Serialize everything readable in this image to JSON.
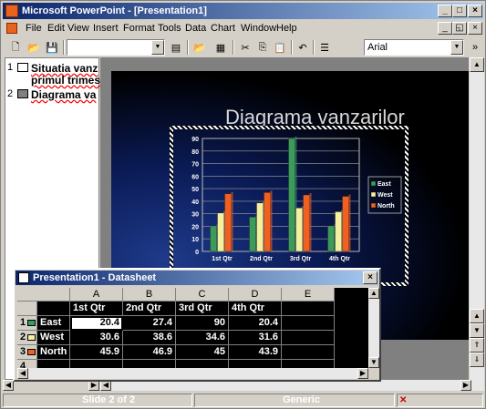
{
  "app": {
    "title": "Microsoft PowerPoint - [Presentation1]"
  },
  "menu": [
    "File",
    "Edit",
    "View",
    "Insert",
    "Format",
    "Tools",
    "Data",
    "Chart",
    "Window",
    "Help"
  ],
  "toolbar": {
    "font_name": "Arial"
  },
  "outline": {
    "slides": [
      {
        "num": "1",
        "text_line1": "Situatia vanz",
        "text_line2": "primul trimes"
      },
      {
        "num": "2",
        "text_line1": "Diagrama va"
      }
    ]
  },
  "slide": {
    "title": "Diagrama vanzarilor"
  },
  "status": {
    "slide": "Slide 2 of 2",
    "design": "Generic"
  },
  "datasheet": {
    "title": "Presentation1 - Datasheet",
    "col_letters": [
      "A",
      "B",
      "C",
      "D",
      "E"
    ],
    "col_headers": [
      "1st Qtr",
      "2nd Qtr",
      "3rd Qtr",
      "4th Qtr"
    ],
    "rows": [
      {
        "num": "1",
        "name": "East",
        "values": [
          "20.4",
          "27.4",
          "90",
          "20.4"
        ]
      },
      {
        "num": "2",
        "name": "West",
        "values": [
          "30.6",
          "38.6",
          "34.6",
          "31.6"
        ]
      },
      {
        "num": "3",
        "name": "North",
        "values": [
          "45.9",
          "46.9",
          "45",
          "43.9"
        ]
      },
      {
        "num": "4",
        "name": "",
        "values": [
          "",
          "",
          "",
          ""
        ]
      }
    ]
  },
  "chart_data": {
    "type": "bar",
    "categories": [
      "1st Qtr",
      "2nd Qtr",
      "3rd Qtr",
      "4th Qtr"
    ],
    "series": [
      {
        "name": "East",
        "values": [
          20.4,
          27.4,
          90,
          20.4
        ],
        "color": "#3c9a5a"
      },
      {
        "name": "West",
        "values": [
          30.6,
          38.6,
          34.6,
          31.6
        ],
        "color": "#f5f0a0"
      },
      {
        "name": "North",
        "values": [
          45.9,
          46.9,
          45,
          43.9
        ],
        "color": "#f06020"
      }
    ],
    "ylim": [
      0,
      90
    ],
    "yticks": [
      "0",
      "10",
      "20",
      "30",
      "40",
      "50",
      "60",
      "70",
      "80",
      "90"
    ],
    "legend_position": "right",
    "grid": true
  }
}
